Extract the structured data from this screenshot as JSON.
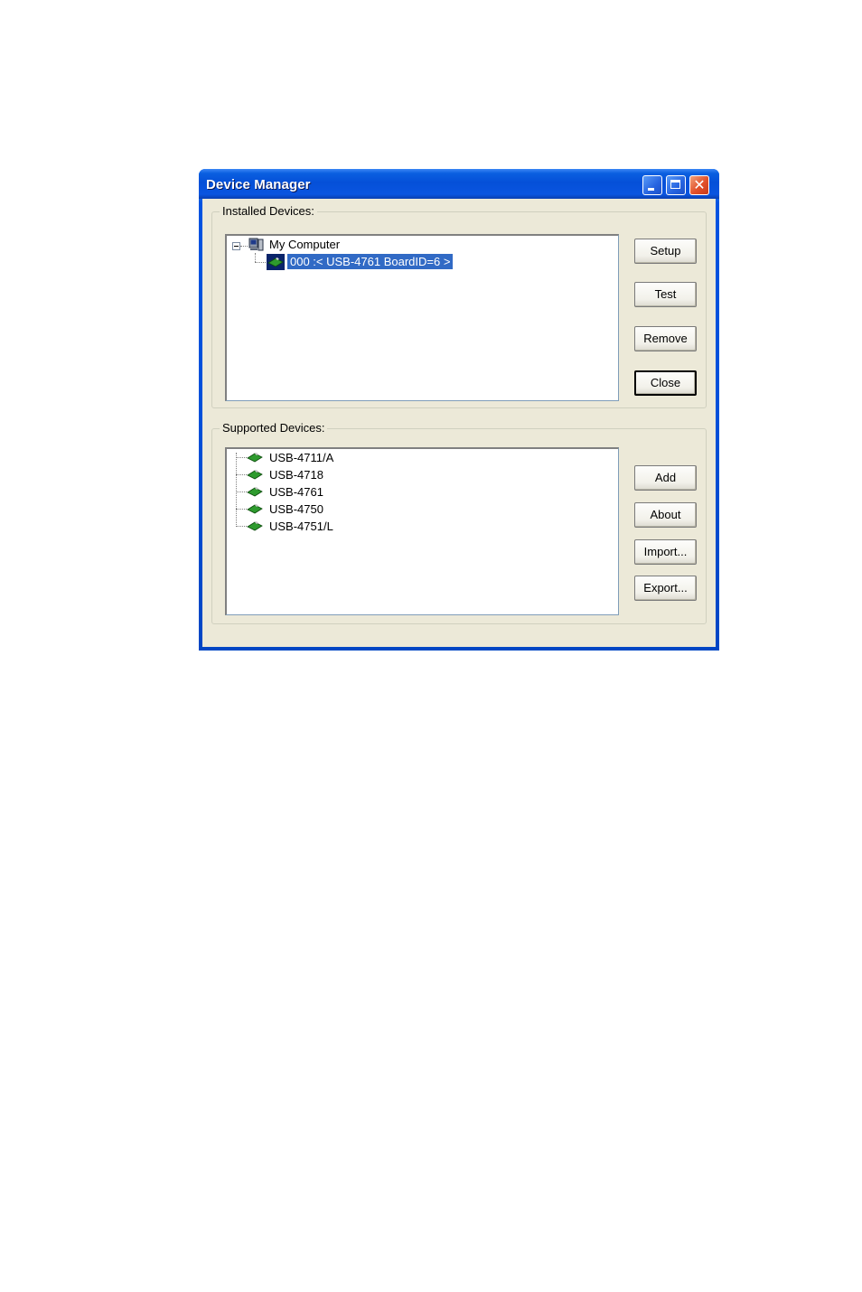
{
  "window": {
    "title": "Device Manager"
  },
  "installed": {
    "legend": "Installed Devices:",
    "root": "My Computer",
    "device": "000 :< USB-4761 BoardID=6 >",
    "buttons": {
      "setup": "Setup",
      "test": "Test",
      "remove": "Remove",
      "close": "Close"
    }
  },
  "supported": {
    "legend": "Supported Devices:",
    "items": [
      "USB-4711/A",
      "USB-4718",
      "USB-4761",
      "USB-4750",
      "USB-4751/L"
    ],
    "buttons": {
      "add": "Add",
      "about": "About",
      "import": "Import...",
      "export": "Export..."
    }
  },
  "colors": {
    "selection": "#316ac5",
    "dialog_bg": "#ece9d8",
    "titlebar": "#0550d8"
  },
  "icons": {
    "computer": "computer-icon",
    "device_card": "device-card-icon"
  }
}
